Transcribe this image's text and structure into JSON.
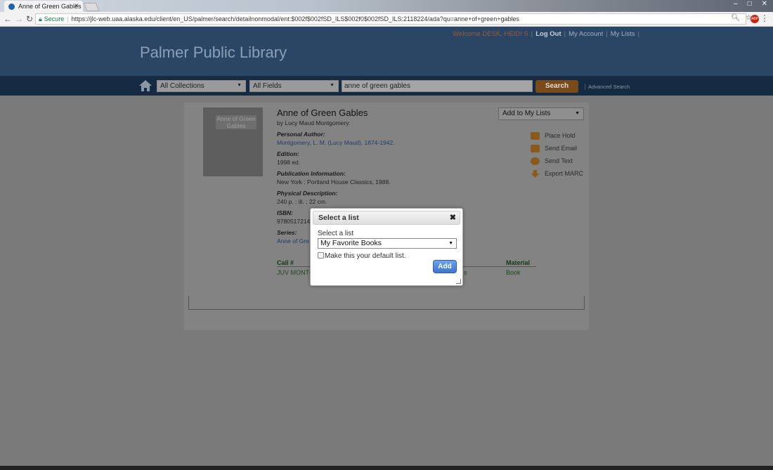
{
  "browser": {
    "tab_title": "Anne of Green Gables",
    "tab_close": "×",
    "secure_label": "Secure",
    "url": "https://jlc-web.uaa.alaska.edu/client/en_US/palmer/search/detailnonmodal/ent:$002f$002fSD_ILS$002f0$002fSD_ILS:2118224/ada?qu=anne+of+green+gables",
    "controls": [
      "–",
      "□",
      "✕"
    ]
  },
  "header": {
    "site_title": "Palmer Public Library",
    "welcome": "Welcome DESK, HEIDI S",
    "log_out": "Log Out",
    "my_account": "My Account",
    "my_lists": "My Lists"
  },
  "search": {
    "collection": "All Collections",
    "field": "All Fields",
    "query": "anne of green gables",
    "button": "Search",
    "advanced": "Advanced Search"
  },
  "record": {
    "cover_text": "Anne of Green Gables",
    "title": "Anne of Green Gables",
    "byline": "by Lucy Maud Montgomery.",
    "personal_author_label": "Personal Author:",
    "personal_author": "Montgomery, L. M. (Lucy Maud), 1874-1942.",
    "edition_label": "Edition:",
    "edition": "1998 ed.",
    "pub_label": "Publication Information:",
    "pub": "New York : Portland House Classics, 1988.",
    "phys_label": "Physical Description:",
    "phys": "240 p. : ill. ; 22 cm.",
    "isbn_label": "ISBN:",
    "isbn": "97805172146",
    "series_label": "Series:",
    "series": "Anne of Gre",
    "add_to_lists": "Add to My Lists",
    "actions": [
      "Place Hold",
      "Send Email",
      "Send Text",
      "Export MARC"
    ]
  },
  "holdings": {
    "call_head": "Call #",
    "material_head": "Material",
    "call_value": "JUV MONTGO",
    "status_frag": "s",
    "material_value": "Book"
  },
  "modal": {
    "title": "Select a list",
    "close": "✖",
    "label": "Select a list",
    "selected": "My Favorite Books",
    "checkbox_label": "Make this your default list.",
    "add": "Add"
  }
}
